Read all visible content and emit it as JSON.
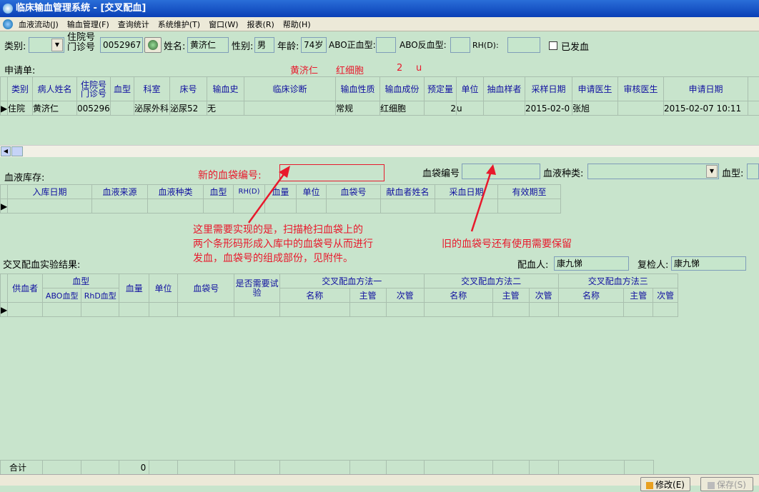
{
  "window": {
    "title": "临床输血管理系统 - [交叉配血]"
  },
  "menu": [
    "血液流动(J)",
    "输血管理(F)",
    "查询统计",
    "系统维护(T)",
    "窗口(W)",
    "报表(R)",
    "帮助(H)"
  ],
  "filters": {
    "category_label": "类别:",
    "inpatient_label": "住院号",
    "outpatient_label": "门诊号",
    "inpatient_no": "0052967",
    "name_label": "姓名:",
    "name": "黄济仁",
    "gender_label": "性别:",
    "gender": "男",
    "age_label": "年龄:",
    "age": "74岁",
    "abo_pos_label": "ABO正血型:",
    "abo_neg_label": "ABO反血型:",
    "rh_label": "RH(D):",
    "issued_label": "已发血"
  },
  "request": {
    "label": "申请单:",
    "summary_name": "黄济仁",
    "summary_component": "红细胞",
    "summary_qty": "2",
    "summary_unit": "u",
    "columns": [
      "类别",
      "病人姓名",
      "住院号门诊号",
      "血型",
      "科室",
      "床号",
      "输血史",
      "临床诊断",
      "输血性质",
      "输血成份",
      "预定量",
      "单位",
      "抽血样者",
      "采样日期",
      "申请医生",
      "审核医生",
      "申请日期"
    ],
    "row": [
      "住院",
      "黄济仁",
      "005296",
      "",
      "泌尿外科",
      "泌尿52",
      "无",
      "",
      "常规",
      "红细胞",
      "2",
      "u",
      "",
      "2015-02-0",
      "张旭",
      "",
      "2015-02-07 10:11"
    ]
  },
  "inventory": {
    "label": "血液库存:",
    "new_bag_label": "新的血袋编号:",
    "bag_no_label": "血袋编号",
    "blood_type_label": "血液种类:",
    "blood_group_label": "血型:",
    "columns": [
      "入库日期",
      "血液来源",
      "血液种类",
      "血型",
      "RH(D)",
      "血量",
      "单位",
      "血袋号",
      "献血者姓名",
      "采血日期",
      "有效期至"
    ]
  },
  "annotations": {
    "left_line1": "这里需要实现的是，扫描枪扫血袋上的",
    "left_line2": "两个条形码形成入库中的血袋号从而进行",
    "left_line3": "发血，血袋号的组成部份，见附件。",
    "right": "旧的血袋号还有使用需要保留"
  },
  "crossmatch": {
    "label": "交叉配血实验结果:",
    "matcher_label": "配血人:",
    "matcher": "康九悌",
    "reviewer_label": "复检人:",
    "reviewer": "康九悌",
    "col_donor": "供血者",
    "col_bloodtype": "血型",
    "col_abo": "ABO血型",
    "col_rhd": "RhD血型",
    "col_volume": "血量",
    "col_unit": "单位",
    "col_bagno": "血袋号",
    "col_retest": "是否需要试验",
    "method1": "交叉配血方法一",
    "method2": "交叉配血方法二",
    "method3": "交叉配血方法三",
    "col_name": "名称",
    "col_main": "主管",
    "col_minor": "次管",
    "total_label": "合计",
    "total_volume": "0"
  },
  "buttons": {
    "edit": "修改(E)",
    "save": "保存(S)"
  }
}
